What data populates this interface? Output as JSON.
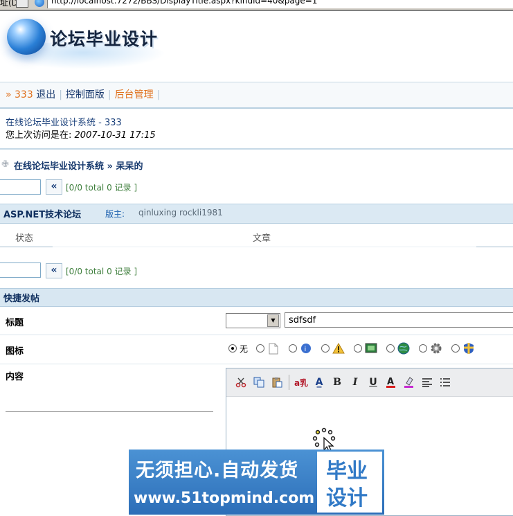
{
  "address_bar": {
    "label": "址(D)",
    "url": "http://localhost:7272/BBS/DisplayTitle.aspx?kindid=40&page=1"
  },
  "logo": {
    "title": "论坛毕业设计"
  },
  "nav": {
    "prefix": "» 333",
    "logout": "退出",
    "control_panel": "控制面版",
    "admin": "后台管理"
  },
  "welcome": {
    "line1": "在线论坛毕业设计系统 - 333",
    "line2_label": "您上次访问是在:",
    "line2_time": "2007-10-31 17:15"
  },
  "breadcrumb": {
    "site": "在线论坛毕业设计系统",
    "sep": "»",
    "current": "呆呆的"
  },
  "pager": {
    "prev": "«",
    "text": "[0/0 total 0 记录 ]"
  },
  "forum": {
    "name": "ASP.NET技术论坛",
    "moderator_label": "版主:",
    "moderators": "qinluxing rockli1981"
  },
  "columns": {
    "status": "状态",
    "article": "文章"
  },
  "quick_post": {
    "title": "快捷发帖",
    "title_label": "标题",
    "title_value": "sdfsdf",
    "icon_label": "图标",
    "icon_none": "无",
    "content_label": "内容"
  },
  "icons": [
    "none",
    "document-icon",
    "info-icon",
    "warning-icon",
    "image-icon",
    "globe-icon",
    "gear-icon",
    "shield-icon"
  ],
  "watermark": {
    "line1": "无须担心.自动发货",
    "line2": "www.51topmind.com",
    "box_line1": "毕业",
    "box_line2": "设计"
  }
}
